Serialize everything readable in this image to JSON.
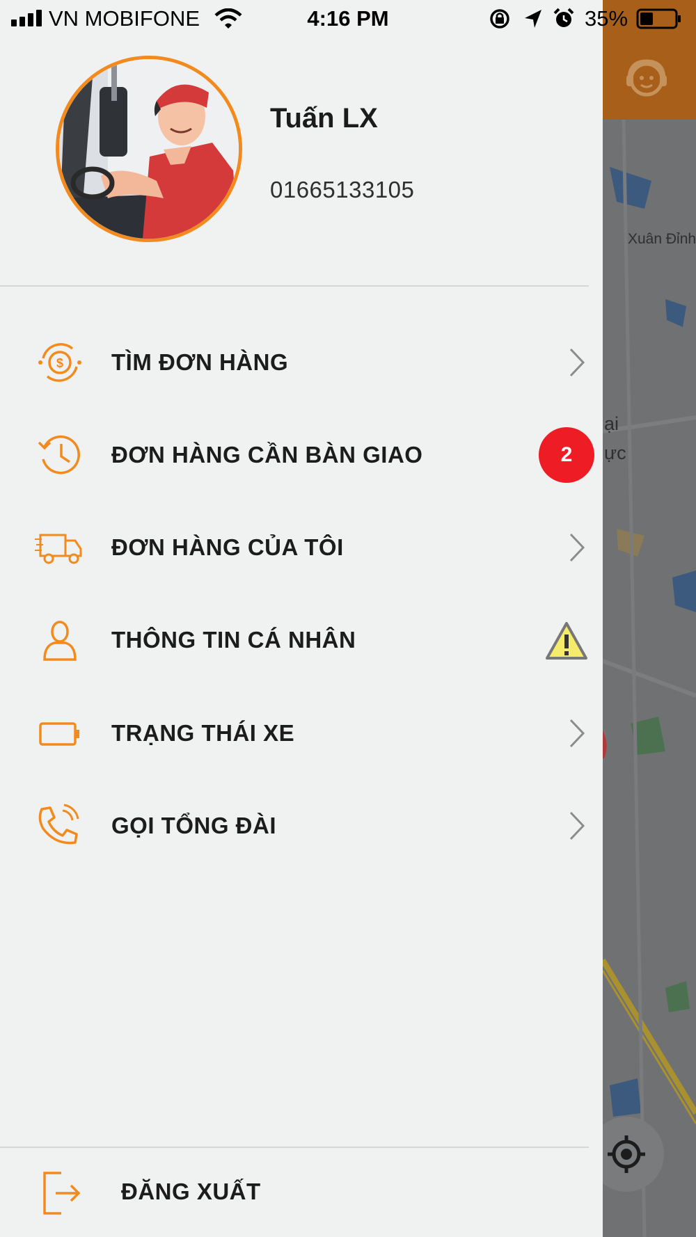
{
  "status_bar": {
    "carrier": "VN MOBIFONE",
    "time": "4:16 PM",
    "battery": "35%"
  },
  "profile": {
    "name": "Tuấn LX",
    "phone": "01665133105"
  },
  "menu": {
    "items": [
      {
        "label": "TÌM ĐƠN HÀNG",
        "icon": "money-cycle-icon"
      },
      {
        "label": "ĐƠN HÀNG CẦN BÀN GIAO",
        "icon": "history-clock-icon",
        "badge": "2"
      },
      {
        "label": "ĐƠN HÀNG CỦA TÔI",
        "icon": "delivery-truck-icon"
      },
      {
        "label": "THÔNG TIN CÁ NHÂN",
        "icon": "user-icon"
      },
      {
        "label": "TRẠNG THÁI XE",
        "icon": "battery-icon"
      },
      {
        "label": "GỌI TỔNG ĐÀI",
        "icon": "phone-call-icon"
      }
    ]
  },
  "logout": {
    "label": "ĐĂNG XUẤT",
    "icon": "logout-icon"
  },
  "map": {
    "places": [
      "Xuân Đỉnh",
      "ại",
      "ực"
    ]
  },
  "colors": {
    "accent": "#f28a1e",
    "badge": "#ee1c24",
    "drawer_bg": "#f0f1f1",
    "topbar": "#a85f1a"
  }
}
